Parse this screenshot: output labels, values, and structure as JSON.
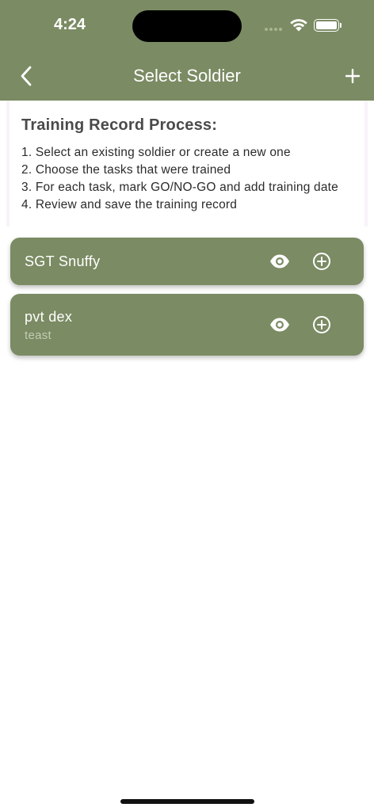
{
  "status_bar": {
    "time": "4:24"
  },
  "nav": {
    "title": "Select Soldier",
    "back_icon": "chevron-left-icon",
    "add_icon": "plus-icon"
  },
  "instructions": {
    "heading": "Training Record Process:",
    "steps": [
      "1. Select an existing soldier or create a new one",
      "2. Choose the tasks that were trained",
      "3. For each task, mark GO/NO-GO and add training date",
      "4. Review and save the training record"
    ]
  },
  "soldiers": [
    {
      "name": "SGT Snuffy",
      "subtitle": ""
    },
    {
      "name": "pvt dex",
      "subtitle": "teast"
    }
  ],
  "colors": {
    "primary": "#7b8b63",
    "subtitle": "#c3ccb3"
  }
}
